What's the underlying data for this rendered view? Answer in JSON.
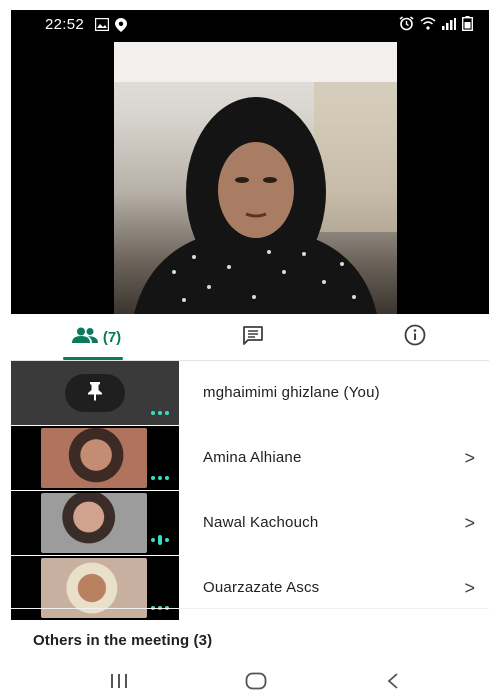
{
  "status_bar": {
    "time": "22:52"
  },
  "tabs": {
    "people_count": "(7)",
    "active": "people"
  },
  "participants": [
    {
      "name": "mghaimimi ghizlane (You)",
      "has_chevron": false
    },
    {
      "name": "Amina Alhiane",
      "has_chevron": true
    },
    {
      "name": "Nawal Kachouch",
      "has_chevron": true
    },
    {
      "name": "Ouarzazate Ascs",
      "has_chevron": true
    }
  ],
  "chevron": ">",
  "others_label": "Others in the meeting (3)",
  "colors": {
    "accent": "#0b7a5c",
    "audio_dots": "#36e0c0"
  },
  "icons": {
    "tab_people": "people-icon",
    "tab_chat": "chat-icon",
    "tab_info": "info-icon",
    "pin": "pin-icon",
    "nav_recents": "recents-icon",
    "nav_home": "home-icon",
    "nav_back": "back-icon"
  }
}
